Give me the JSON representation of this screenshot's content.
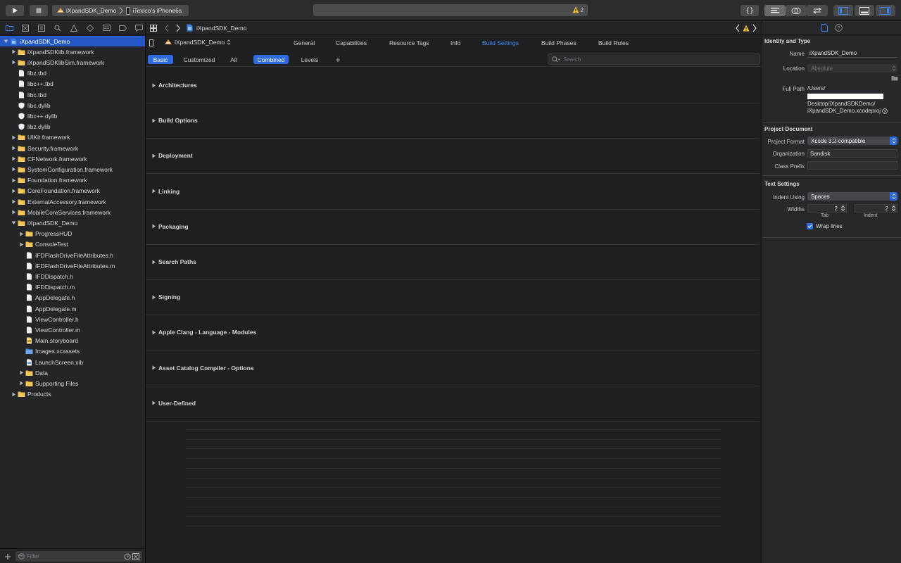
{
  "toolbar": {
    "scheme_target": "iXpandSDK_Demo",
    "scheme_device": "iTexico’s iPhone6s",
    "warning_count": "2"
  },
  "jumpbar": {
    "project": "iXpandSDK_Demo"
  },
  "navigator": {
    "items": [
      {
        "label": "iXpandSDK_Demo",
        "icon": "project-icon",
        "level": 0,
        "disclosure": "open",
        "selected": true
      },
      {
        "label": "iXpandSDKlib.framework",
        "icon": "folder-icon",
        "level": 1,
        "disclosure": "closed"
      },
      {
        "label": "iXpandSDKlibSim.framework",
        "icon": "folder-icon",
        "level": 1,
        "disclosure": "closed"
      },
      {
        "label": "libz.tbd",
        "icon": "file-icon",
        "level": 1,
        "disclosure": "none"
      },
      {
        "label": "libc++.tbd",
        "icon": "file-icon",
        "level": 1,
        "disclosure": "none"
      },
      {
        "label": "libc.tbd",
        "icon": "file-icon",
        "level": 1,
        "disclosure": "none"
      },
      {
        "label": "libc.dylib",
        "icon": "library-icon",
        "level": 1,
        "disclosure": "none"
      },
      {
        "label": "libc++.dylib",
        "icon": "library-icon",
        "level": 1,
        "disclosure": "none"
      },
      {
        "label": "libz.dylib",
        "icon": "library-icon",
        "level": 1,
        "disclosure": "none"
      },
      {
        "label": "UIKit.framework",
        "icon": "folder-icon",
        "level": 1,
        "disclosure": "closed"
      },
      {
        "label": "Security.framework",
        "icon": "folder-icon",
        "level": 1,
        "disclosure": "closed"
      },
      {
        "label": "CFNetwork.framework",
        "icon": "folder-icon",
        "level": 1,
        "disclosure": "closed"
      },
      {
        "label": "SystemConfiguration.framework",
        "icon": "folder-icon",
        "level": 1,
        "disclosure": "closed"
      },
      {
        "label": "Foundation.framework",
        "icon": "folder-icon",
        "level": 1,
        "disclosure": "closed"
      },
      {
        "label": "CoreFoundation.framework",
        "icon": "folder-icon",
        "level": 1,
        "disclosure": "closed"
      },
      {
        "label": "ExternalAccessory.framework",
        "icon": "folder-icon",
        "level": 1,
        "disclosure": "closed"
      },
      {
        "label": "MobileCoreServices.framework",
        "icon": "folder-icon",
        "level": 1,
        "disclosure": "closed"
      },
      {
        "label": "iXpandSDK_Demo",
        "icon": "folder-icon",
        "level": 1,
        "disclosure": "open"
      },
      {
        "label": "ProgressHUD",
        "icon": "folder-icon",
        "level": 2,
        "disclosure": "closed"
      },
      {
        "label": "ConsoleTest",
        "icon": "folder-icon",
        "level": 2,
        "disclosure": "closed"
      },
      {
        "label": "IFDFlashDriveFileAttributes.h",
        "icon": "file-icon",
        "level": 2,
        "disclosure": "none"
      },
      {
        "label": "IFDFlashDriveFileAttributes.m",
        "icon": "file-icon",
        "level": 2,
        "disclosure": "none"
      },
      {
        "label": "IFDDispatch.h",
        "icon": "file-icon",
        "level": 2,
        "disclosure": "none"
      },
      {
        "label": "IFDDispatch.m",
        "icon": "file-icon",
        "level": 2,
        "disclosure": "none"
      },
      {
        "label": "AppDelegate.h",
        "icon": "file-icon",
        "level": 2,
        "disclosure": "none"
      },
      {
        "label": "AppDelegate.m",
        "icon": "file-icon",
        "level": 2,
        "disclosure": "none"
      },
      {
        "label": "ViewController.h",
        "icon": "file-icon",
        "level": 2,
        "disclosure": "none"
      },
      {
        "label": "ViewController.m",
        "icon": "file-icon",
        "level": 2,
        "disclosure": "none"
      },
      {
        "label": "Main.storyboard",
        "icon": "storyboard-icon",
        "level": 2,
        "disclosure": "none"
      },
      {
        "label": "Images.xcassets",
        "icon": "asset-folder-icon",
        "level": 2,
        "disclosure": "none"
      },
      {
        "label": "LaunchScreen.xib",
        "icon": "xib-icon",
        "level": 2,
        "disclosure": "none"
      },
      {
        "label": "Data",
        "icon": "folder-icon",
        "level": 2,
        "disclosure": "closed"
      },
      {
        "label": "Supporting Files",
        "icon": "folder-icon",
        "level": 2,
        "disclosure": "closed"
      },
      {
        "label": "Products",
        "icon": "folder-icon",
        "level": 1,
        "disclosure": "closed"
      }
    ],
    "filter_placeholder": "Filter"
  },
  "editor": {
    "target_name": "iXpandSDK_Demo",
    "tabs": [
      "General",
      "Capabilities",
      "Resource Tags",
      "Info",
      "Build Settings",
      "Build Phases",
      "Build Rules"
    ],
    "active_tab": "Build Settings",
    "filter_scope": [
      "Basic",
      "Customized",
      "All"
    ],
    "filter_view": [
      "Combined",
      "Levels"
    ],
    "add_label": "+",
    "search_placeholder": "Search",
    "sections": [
      "Architectures",
      "Build Options",
      "Deployment",
      "Linking",
      "Packaging",
      "Search Paths",
      "Signing",
      "Apple Clang - Language - Modules",
      "Asset Catalog Compiler - Options",
      "User-Defined"
    ]
  },
  "inspector": {
    "identity_header": "Identity and Type",
    "name_label": "Name",
    "name_value": "iXpandSDK_Demo",
    "location_label": "Location",
    "location_value": "Absolute",
    "full_path_label": "Full Path",
    "full_path_line1": "/Users/",
    "full_path_line3": "Desktop/iXpandSDKDemo/",
    "full_path_line4": "iXpandSDK_Demo.xcodeproj",
    "project_document_header": "Project Document",
    "project_format_label": "Project Format",
    "project_format_value": "Xcode 3.2-compatible",
    "organization_label": "Organization",
    "organization_value": "Sandisk",
    "class_prefix_label": "Class Prefix",
    "class_prefix_value": "",
    "text_settings_header": "Text Settings",
    "indent_using_label": "Indent Using",
    "indent_using_value": "Spaces",
    "widths_label": "Widths",
    "tab_width": "2",
    "indent_width": "2",
    "tab_caption": "Tab",
    "indent_caption": "Indent",
    "wrap_lines_label": "Wrap lines",
    "wrap_lines_checked": true
  },
  "colors": {
    "accent": "#2f6be0",
    "selection": "#2458c6",
    "folder": "#e8b44a",
    "warning": "#f0c43a"
  }
}
